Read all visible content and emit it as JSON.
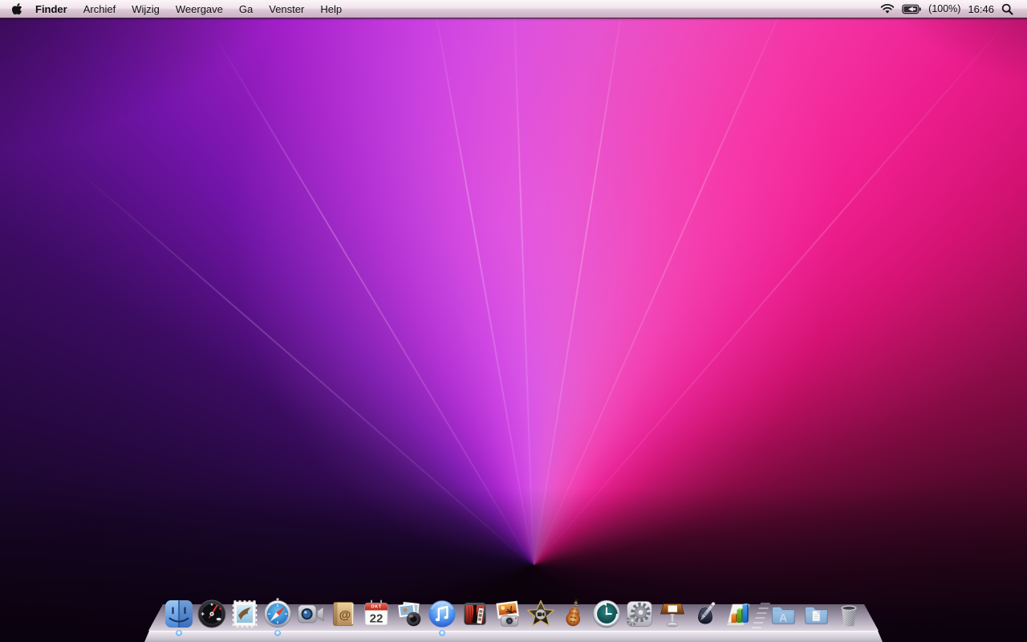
{
  "menubar": {
    "apple_icon": "apple-logo",
    "items": [
      {
        "label": "Finder",
        "bold": true
      },
      {
        "label": "Archief"
      },
      {
        "label": "Wijzig"
      },
      {
        "label": "Weergave"
      },
      {
        "label": "Ga"
      },
      {
        "label": "Venster"
      },
      {
        "label": "Help"
      }
    ],
    "status": {
      "wifi_icon": "wifi",
      "battery_icon": "battery-charging",
      "battery_label": "(100%)",
      "clock": "16:46",
      "spotlight_icon": "magnifier"
    }
  },
  "dock": {
    "glyphs": {
      "calendar_month": "OKT",
      "calendar_day": "22",
      "address_at": "@",
      "applications_letter": "A"
    },
    "items": [
      {
        "icon": "finder-icon",
        "running": true
      },
      {
        "icon": "dashboard-icon",
        "running": false
      },
      {
        "icon": "mail-icon",
        "running": false
      },
      {
        "icon": "safari-icon",
        "running": true
      },
      {
        "icon": "facetime-icon",
        "running": false
      },
      {
        "icon": "address-book-icon",
        "running": false
      },
      {
        "icon": "ical-icon",
        "running": false
      },
      {
        "icon": "aperture-icon",
        "running": false
      },
      {
        "icon": "itunes-icon",
        "running": true
      },
      {
        "icon": "photo-booth-icon",
        "running": false
      },
      {
        "icon": "iphoto-icon",
        "running": false
      },
      {
        "icon": "imovie-icon",
        "running": false
      },
      {
        "icon": "garageband-icon",
        "running": false
      },
      {
        "icon": "time-machine-icon",
        "running": false
      },
      {
        "icon": "system-preferences-icon",
        "running": false
      },
      {
        "icon": "keynote-icon",
        "running": false
      },
      {
        "icon": "pages-icon",
        "running": false
      },
      {
        "icon": "numbers-icon",
        "running": false
      },
      {
        "icon": "applications-folder-icon",
        "running": false
      },
      {
        "icon": "documents-folder-icon",
        "running": false
      },
      {
        "icon": "trash-icon",
        "running": false
      }
    ]
  },
  "wallpaper": {
    "style": "aurora-purple-pink",
    "colors": {
      "dark_edge": "#0e020a",
      "deep_purple": "#3c0c63",
      "violet": "#a21fc9",
      "bright_magenta": "#ea4ec0",
      "hot_pink": "#e81b8c",
      "crimson": "#cc0e6b"
    }
  }
}
